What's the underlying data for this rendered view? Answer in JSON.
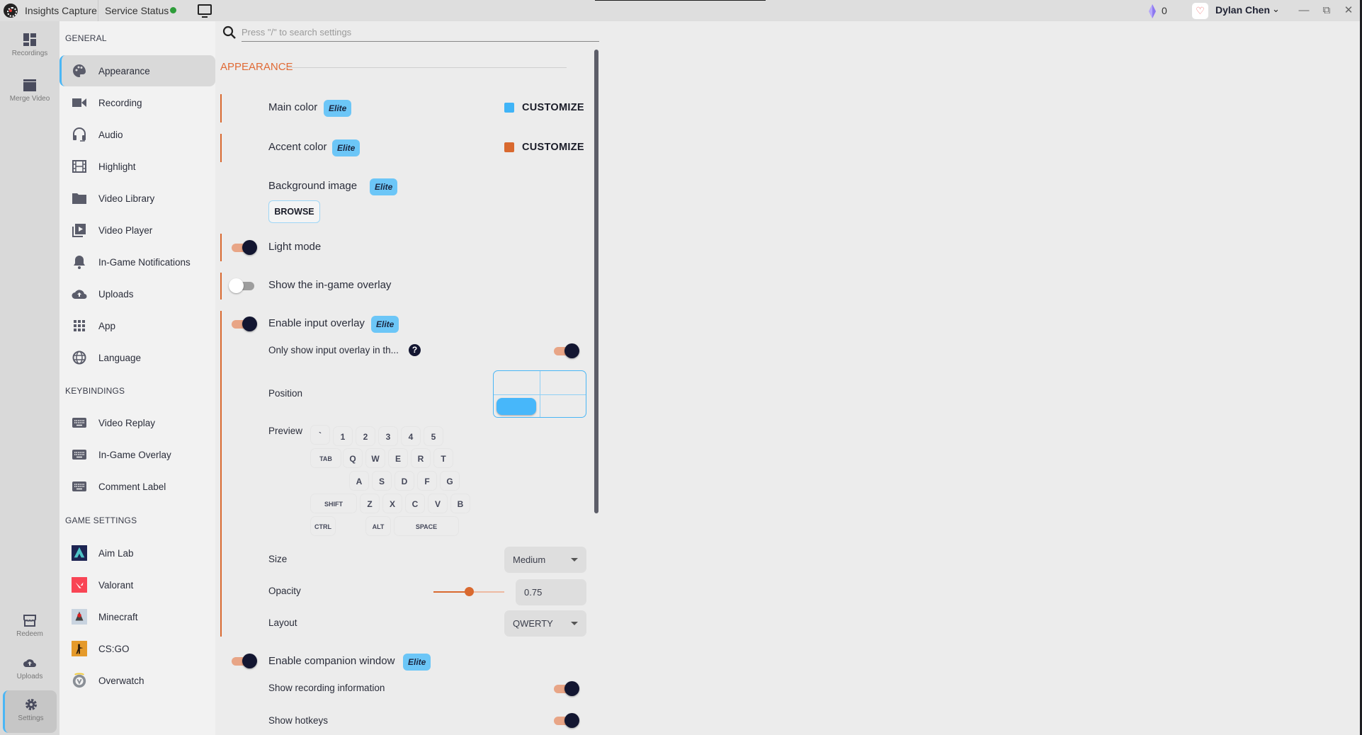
{
  "titlebar": {
    "app_name": "Insights Capture",
    "service_status_label": "Service Status",
    "service_status_color": "#2e9d3a",
    "gem_count": "0",
    "user_name": "Dylan Chen",
    "window_controls": [
      "minimize",
      "restore",
      "close"
    ]
  },
  "rail": {
    "top_items": [
      {
        "label": "Recordings",
        "icon": "dashboard-icon"
      },
      {
        "label": "Merge Video",
        "icon": "clapperboard-icon"
      }
    ],
    "bottom_items": [
      {
        "label": "Redeem",
        "icon": "store-icon"
      },
      {
        "label": "Uploads",
        "icon": "cloud-upload-icon"
      },
      {
        "label": "Settings",
        "icon": "gear-icon",
        "active": true
      }
    ]
  },
  "sidebar": {
    "general_heading": "GENERAL",
    "general_items": [
      {
        "label": "Appearance",
        "icon": "palette-icon",
        "active": true
      },
      {
        "label": "Recording",
        "icon": "video-camera-icon"
      },
      {
        "label": "Audio",
        "icon": "headset-icon"
      },
      {
        "label": "Highlight",
        "icon": "film-icon"
      },
      {
        "label": "Video Library",
        "icon": "folder-icon"
      },
      {
        "label": "Video Player",
        "icon": "video-library-icon"
      },
      {
        "label": "In-Game Notifications",
        "icon": "bell-icon"
      },
      {
        "label": "Uploads",
        "icon": "cloud-upload-icon"
      },
      {
        "label": "App",
        "icon": "apps-grid-icon"
      },
      {
        "label": "Language",
        "icon": "globe-icon"
      }
    ],
    "keybindings_heading": "KEYBINDINGS",
    "keybinding_items": [
      {
        "label": "Video Replay",
        "icon": "keyboard-icon"
      },
      {
        "label": "In-Game Overlay",
        "icon": "keyboard-icon"
      },
      {
        "label": "Comment Label",
        "icon": "keyboard-icon"
      }
    ],
    "game_heading": "GAME SETTINGS",
    "game_items": [
      {
        "label": "Aim Lab",
        "icon": "aim-lab-logo"
      },
      {
        "label": "Valorant",
        "icon": "valorant-logo"
      },
      {
        "label": "Minecraft",
        "icon": "minecraft-logo"
      },
      {
        "label": "CS:GO",
        "icon": "csgo-logo"
      },
      {
        "label": "Overwatch",
        "icon": "overwatch-logo"
      }
    ]
  },
  "search": {
    "placeholder": "Press \"/\" to search settings",
    "value": ""
  },
  "appearance": {
    "section_title": "APPEARANCE",
    "elite_badge": "Elite",
    "main_color": {
      "label": "Main color",
      "action": "CUSTOMIZE",
      "color": "#40b4f7"
    },
    "accent_color": {
      "label": "Accent color",
      "action": "CUSTOMIZE",
      "color": "#d9692f"
    },
    "background_image": {
      "label": "Background image",
      "action": "BROWSE"
    },
    "light_mode": {
      "label": "Light mode",
      "enabled": true
    },
    "ingame_overlay": {
      "label": "Show the in-game overlay",
      "enabled": false
    },
    "input_overlay": {
      "label": "Enable input overlay",
      "enabled": true,
      "only_show": {
        "label": "Only show input overlay in th...",
        "enabled": true
      },
      "position": {
        "label": "Position",
        "selected": "bottom-left"
      },
      "preview": {
        "label": "Preview",
        "rows": [
          [
            "`",
            "1",
            "2",
            "3",
            "4",
            "5"
          ],
          [
            "TAB",
            "Q",
            "W",
            "E",
            "R",
            "T"
          ],
          [
            "A",
            "S",
            "D",
            "F",
            "G"
          ],
          [
            "SHIFT",
            "Z",
            "X",
            "C",
            "V",
            "B"
          ],
          [
            "CTRL",
            "ALT",
            "SPACE"
          ]
        ]
      },
      "size": {
        "label": "Size",
        "value": "Medium"
      },
      "opacity": {
        "label": "Opacity",
        "value": "0.75",
        "slider_fraction": 0.5
      },
      "layout": {
        "label": "Layout",
        "value": "QWERTY"
      }
    },
    "companion_window": {
      "label": "Enable companion window",
      "enabled": true,
      "show_recording_info": {
        "label": "Show recording information",
        "enabled": true
      },
      "show_hotkeys": {
        "label": "Show hotkeys",
        "enabled": true
      }
    }
  }
}
